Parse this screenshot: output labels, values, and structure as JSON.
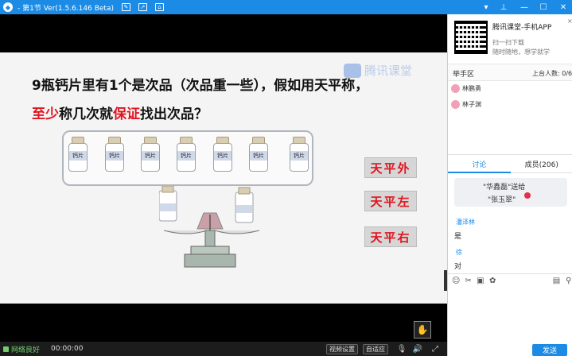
{
  "window": {
    "title": "- 第1节 Ver(1.5.6.146 Beta)",
    "controls": [
      "—",
      "⇪",
      "—",
      "☐",
      "✕"
    ]
  },
  "slide": {
    "question_line1": "9瓶钙片里有1个是次品（次品重一些），假如用天平称，",
    "question_line2_prefix": "",
    "q2_red1": "至少",
    "q2_mid": "称几次就",
    "q2_red2": "保证",
    "q2_suffix": "找出次品？",
    "watermark": "腾讯课堂",
    "bottle_label": "钙片",
    "options": [
      "天平外",
      "天平左",
      "天平右"
    ]
  },
  "statusbar": {
    "network": "网络良好",
    "time": "00:00:00",
    "video_settings": "视频设置",
    "auto_fit": "自适应"
  },
  "panel": {
    "app_title": "腾讯课堂-手机APP",
    "app_sub1": "扫一扫下载",
    "app_sub2": "随时随地，想学就学",
    "close": "×",
    "hands_title": "举手区",
    "stage_count": "上台人数: 0/6",
    "hands": [
      "林鹏勇",
      "林子渊"
    ],
    "tab_discuss": "讨论",
    "tab_members": "成员(206)",
    "gift_line1": "\"华鑫磊\"送给",
    "gift_line2": "\"张玉翠\"",
    "messages": [
      {
        "name": "潘泽林",
        "text": "是"
      },
      {
        "name": "徐",
        "text": "对"
      }
    ],
    "send": "发送"
  },
  "colors": {
    "accent": "#1b8be6",
    "highlight_red": "#e0141e"
  }
}
